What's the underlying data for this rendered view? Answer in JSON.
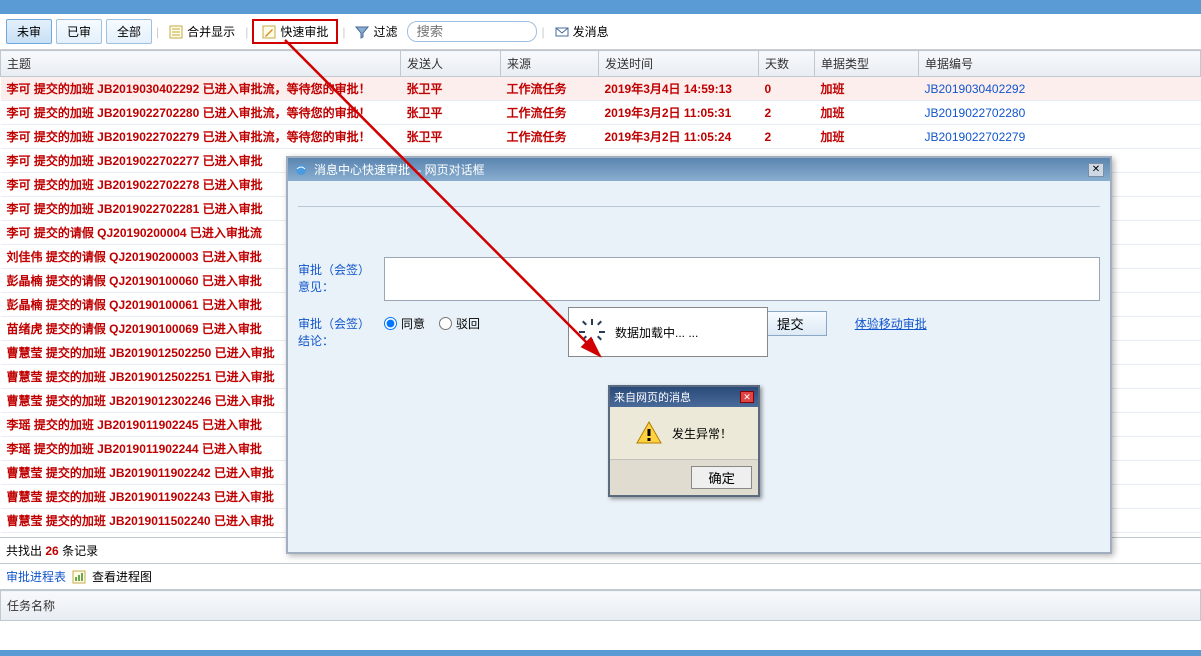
{
  "toolbar": {
    "tabs": {
      "pending": "未审",
      "done": "已审",
      "all": "全部"
    },
    "merge_display": "合并显示",
    "quick_approve": "快速审批",
    "filter": "过滤",
    "search_placeholder": "搜索",
    "send_msg": "发消息"
  },
  "columns": {
    "subject": "主题",
    "sender": "发送人",
    "source": "来源",
    "time": "发送时间",
    "days": "天数",
    "type": "单据类型",
    "docno": "单据编号"
  },
  "rows_full": [
    {
      "subject": "李可 提交的加班 JB2019030402292 已进入审批流，等待您的审批！",
      "sender": "张卫平",
      "source": "工作流任务",
      "time": "2019年3月4日 14:59:13",
      "days": "0",
      "type": "加班",
      "docno": "JB2019030402292"
    },
    {
      "subject": "李可 提交的加班 JB2019022702280 已进入审批流，等待您的审批！",
      "sender": "张卫平",
      "source": "工作流任务",
      "time": "2019年3月2日 11:05:31",
      "days": "2",
      "type": "加班",
      "docno": "JB2019022702280"
    },
    {
      "subject": "李可 提交的加班 JB2019022702279 已进入审批流，等待您的审批！",
      "sender": "张卫平",
      "source": "工作流任务",
      "time": "2019年3月2日 11:05:24",
      "days": "2",
      "type": "加班",
      "docno": "JB2019022702279"
    }
  ],
  "rows_trunc": [
    "李可 提交的加班 JB2019022702277 已进入审批",
    "李可 提交的加班 JB2019022702278 已进入审批",
    "李可 提交的加班 JB2019022702281 已进入审批",
    "李可 提交的请假 QJ20190200004 已进入审批流",
    "刘佳伟 提交的请假 QJ20190200003 已进入审批",
    "彭晶楠 提交的请假 QJ20190100060 已进入审批",
    "彭晶楠 提交的请假 QJ20190100061 已进入审批",
    "苗绪虎 提交的请假 QJ20190100069 已进入审批",
    "曹慧莹 提交的加班 JB2019012502250 已进入审批",
    "曹慧莹 提交的加班 JB2019012502251 已进入审批",
    "曹慧莹 提交的加班 JB2019012302246 已进入审批",
    "李瑶 提交的加班 JB2019011902245 已进入审批",
    "李瑶 提交的加班 JB2019011902244 已进入审批",
    "曹慧莹 提交的加班 JB2019011902242 已进入审批",
    "曹慧莹 提交的加班 JB2019011902243 已进入审批",
    "曹慧莹 提交的加班 JB2019011502240 已进入审批"
  ],
  "status": {
    "prefix": "共找出",
    "count": "26",
    "suffix": "条记录"
  },
  "process": {
    "tab_label": "审批进程表",
    "view_chart": "查看进程图"
  },
  "task": {
    "name_col": "任务名称"
  },
  "dialog": {
    "title_text": "消息中心快速审批 -- 网页对话框",
    "opinion_label": "审批（会签）意见：",
    "result_label": "审批（会签）结论：",
    "agree": "同意",
    "reject": "驳回",
    "submit": "提交",
    "mobile": "体验移动审批",
    "loading": "数据加载中... ..."
  },
  "alert": {
    "title": "来自网页的消息",
    "message": "发生异常！",
    "ok": "确定"
  }
}
